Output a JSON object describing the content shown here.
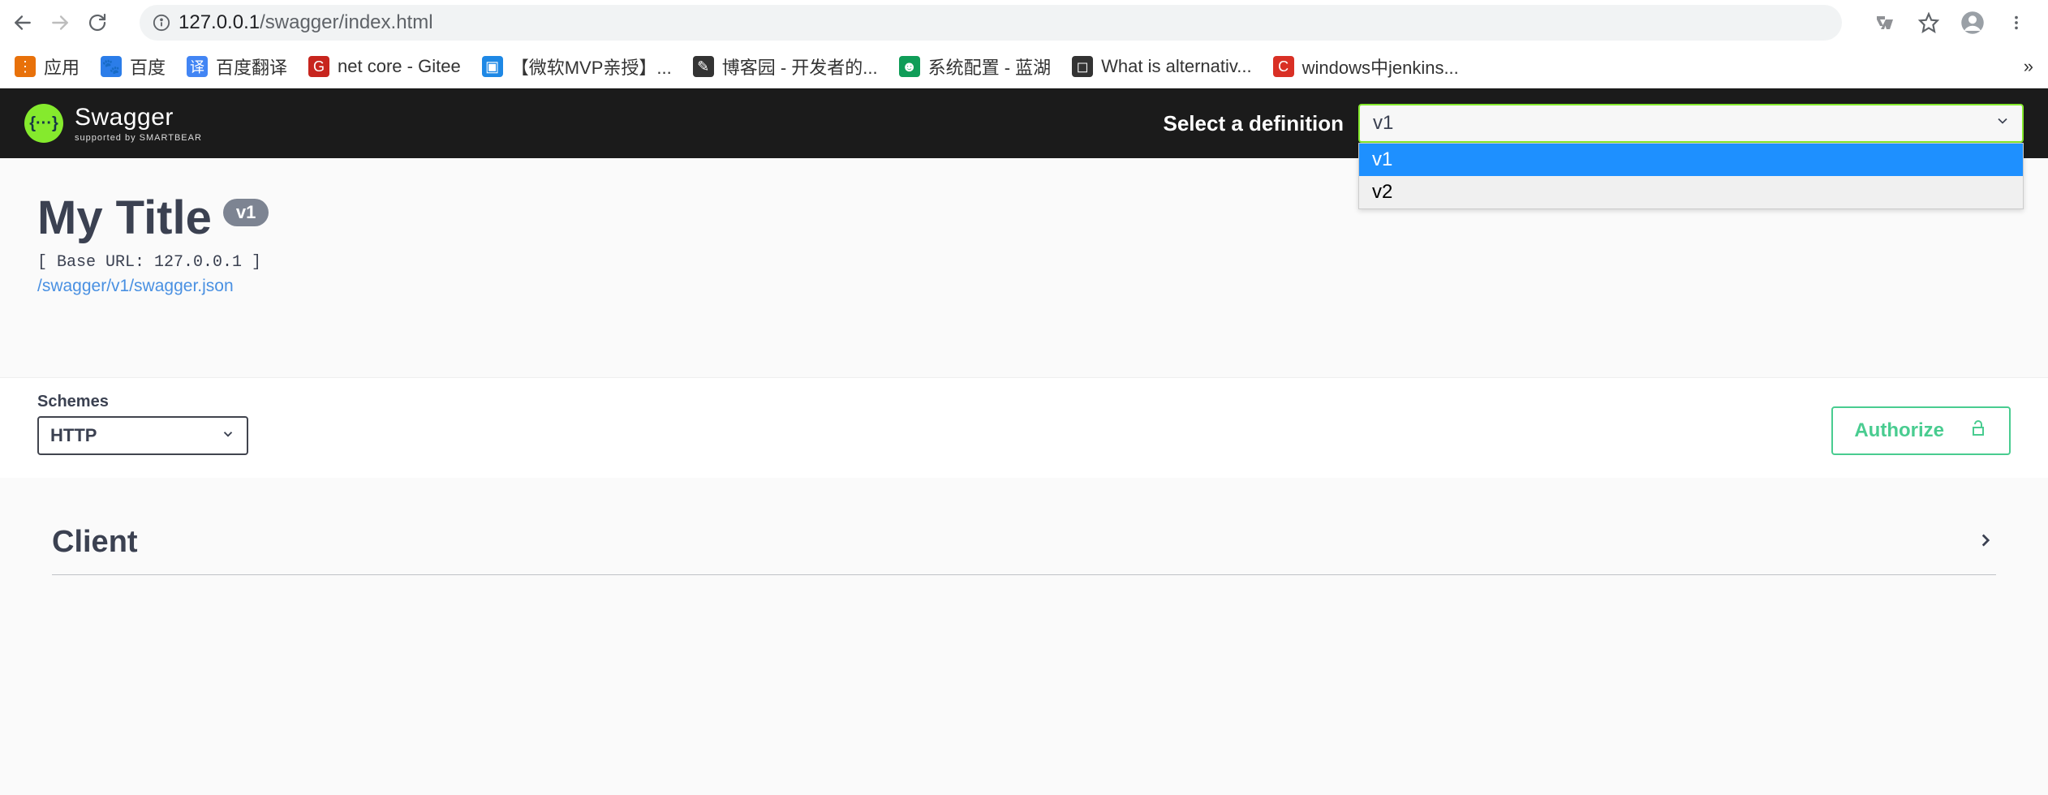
{
  "browser": {
    "url_host": "127.0.0.1",
    "url_path": "/swagger/index.html",
    "bookmarks": [
      {
        "label": "应用",
        "iconColor": "#e8710a",
        "iconChar": "⋮⋮⋮"
      },
      {
        "label": "百度",
        "iconColor": "#2b7de9",
        "iconChar": "🐾"
      },
      {
        "label": "百度翻译",
        "iconColor": "#4285f4",
        "iconChar": "译"
      },
      {
        "label": "net core - Gitee",
        "iconColor": "#c7251e",
        "iconChar": "G"
      },
      {
        "label": "【微软MVP亲授】...",
        "iconColor": "#1e88e5",
        "iconChar": "▣"
      },
      {
        "label": "博客园 - 开发者的...",
        "iconColor": "#333",
        "iconChar": "✎"
      },
      {
        "label": "系统配置 - 蓝湖",
        "iconColor": "#0f9d58",
        "iconChar": "☻"
      },
      {
        "label": "What is alternativ...",
        "iconColor": "#333",
        "iconChar": "◻"
      },
      {
        "label": "windows中jenkins...",
        "iconColor": "#d93025",
        "iconChar": "C"
      }
    ],
    "overflow": "»"
  },
  "swagger": {
    "brand": "Swagger",
    "brandMono": "{···}",
    "supported": "supported by SMARTBEAR",
    "select_label": "Select a definition",
    "definition_selected": "v1",
    "definition_options": [
      "v1",
      "v2"
    ]
  },
  "api": {
    "title": "My Title",
    "version_badge": "v1",
    "base_url": "[ Base URL: 127.0.0.1 ]",
    "json_link": "/swagger/v1/swagger.json"
  },
  "schemes": {
    "label": "Schemes",
    "value": "HTTP"
  },
  "authorize": {
    "label": "Authorize"
  },
  "tags": [
    {
      "name": "Client"
    }
  ]
}
